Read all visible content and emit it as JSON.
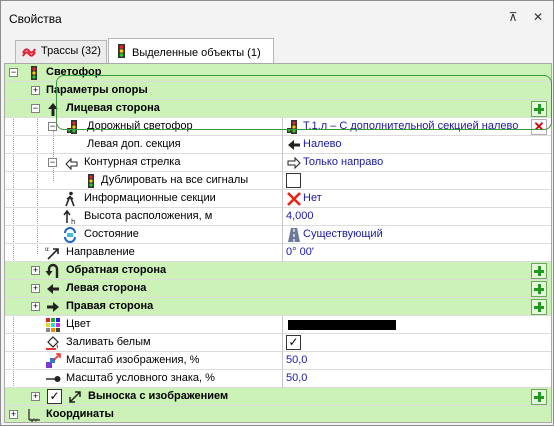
{
  "window": {
    "title": "Свойства",
    "pin_glyph": "⊼",
    "close_glyph": "✕"
  },
  "tabs": [
    {
      "label": "Трассы (32)",
      "icon": "route-icon"
    },
    {
      "label": "Выделенные объекты (1)",
      "icon": "traffic-light-icon"
    }
  ],
  "grid": {
    "root": {
      "label": "Светофор"
    },
    "support_params": {
      "label": "Параметры опоры"
    },
    "front_side": {
      "label": "Лицевая сторона"
    },
    "road_light": {
      "label": "Дорожный светофор",
      "value": "Т.1.л – С дополнительной секцией налево"
    },
    "left_section": {
      "label": "Левая доп. секция",
      "value": "Налево"
    },
    "contour_arrow": {
      "label": "Контурная стрелка",
      "value": "Только направо"
    },
    "duplicate": {
      "label": "Дублировать на все сигналы",
      "checked": false
    },
    "info_sections": {
      "label": "Информационные секции",
      "value": "Нет"
    },
    "height": {
      "label": "Высота расположения, м",
      "value": "4,000"
    },
    "state": {
      "label": "Состояние",
      "value": "Существующий"
    },
    "direction": {
      "label": "Направление",
      "value": "0° 00'"
    },
    "back_side": {
      "label": "Обратная сторона"
    },
    "left_side": {
      "label": "Левая сторона"
    },
    "right_side": {
      "label": "Правая сторона"
    },
    "color": {
      "label": "Цвет",
      "value_color": "#000000"
    },
    "fill_white": {
      "label": "Заливать белым",
      "checked": true
    },
    "image_scale": {
      "label": "Масштаб изображения, %",
      "value": "50,0"
    },
    "symbol_scale": {
      "label": "Масштаб условного знака, %",
      "value": "50,0"
    },
    "callout": {
      "label": "Выноска с изображением",
      "checked": true
    },
    "coords": {
      "label": "Координаты"
    }
  },
  "colors": {
    "category_bg": "#cdf2b8",
    "value_text": "#1a1aa6",
    "highlight": "#3a9a3a"
  }
}
